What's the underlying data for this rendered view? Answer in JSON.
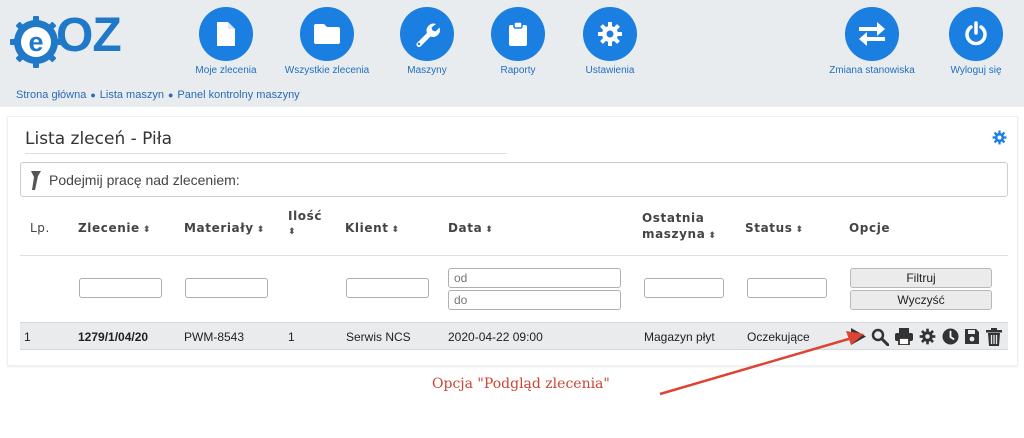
{
  "header": {
    "logo_text": "OZ",
    "logo_letter": "e",
    "nav": [
      {
        "label": "Moje zlecenia",
        "icon": "document-icon"
      },
      {
        "label": "Wszystkie zlecenia",
        "icon": "folder-icon"
      },
      {
        "label": "Maszyny",
        "icon": "wrench-icon"
      },
      {
        "label": "Raporty",
        "icon": "clipboard-icon"
      },
      {
        "label": "Ustawienia",
        "icon": "gear-icon"
      }
    ],
    "nav_right": [
      {
        "label": "Zmiana stanowiska",
        "icon": "switch-arrows-icon"
      },
      {
        "label": "Wyloguj się",
        "icon": "power-icon"
      }
    ]
  },
  "breadcrumb": [
    "Strona główna",
    "Lista maszyn",
    "Panel kontrolny maszyny"
  ],
  "panel": {
    "title": "Lista zleceń - Piła",
    "scan_label": "Podejmij pracę nad zleceniem:"
  },
  "table": {
    "headers": {
      "lp": "Lp.",
      "zlecenie": "Zlecenie",
      "materialy": "Materiały",
      "ilosc": "Ilość",
      "klient": "Klient",
      "data": "Data",
      "ostatnia_1": "Ostatnia",
      "ostatnia_2": "maszyna",
      "status": "Status",
      "opcje": "Opcje"
    },
    "filters": {
      "date_from_placeholder": "od",
      "date_to_placeholder": "do",
      "filter_button": "Filtruj",
      "clear_button": "Wyczyść"
    },
    "rows": [
      {
        "lp": "1",
        "zlecenie": "1279/1/04/20",
        "materialy": "PWM-8543",
        "ilosc": "1",
        "klient": "Serwis NCS",
        "data": "2020-04-22 09:00",
        "ostatnia_maszyna": "Magazyn płyt",
        "status": "Oczekujące"
      }
    ],
    "option_icons": [
      "play-icon",
      "search-icon",
      "print-icon",
      "gear-icon",
      "clock-icon",
      "save-icon",
      "trash-icon"
    ]
  },
  "annotation": {
    "text": "Opcja \"Podgląd zlecenia\"",
    "color": "#cc4433"
  },
  "colors": {
    "brand": "#1a7fe0",
    "header_bg": "#e9ecef",
    "row_bg": "#e9ebed"
  }
}
